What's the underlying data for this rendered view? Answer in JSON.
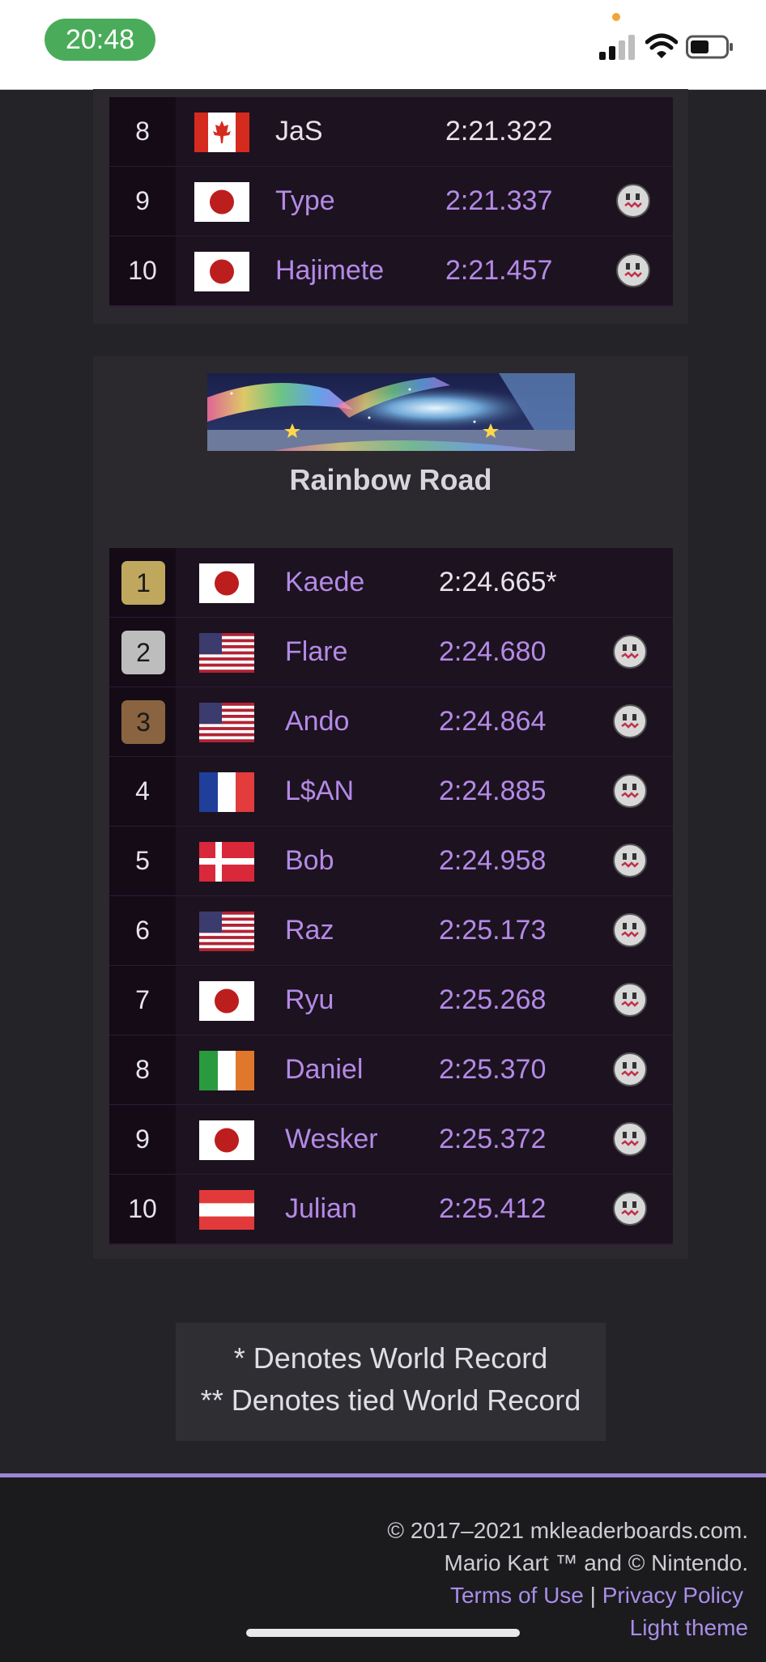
{
  "status": {
    "time": "20:48"
  },
  "top_table": {
    "rows": [
      {
        "rank": "8",
        "flag": "canada",
        "name": "JaS",
        "time": "2:21.322",
        "ghost": false
      },
      {
        "rank": "9",
        "flag": "japan",
        "name": "Type",
        "time": "2:21.337",
        "ghost": true
      },
      {
        "rank": "10",
        "flag": "japan",
        "name": "Hajimete",
        "time": "2:21.457",
        "ghost": true
      }
    ]
  },
  "rainbow": {
    "title": "Rainbow Road",
    "rows": [
      {
        "rank": "1",
        "medal": "gold",
        "flag": "japan",
        "name": "Kaede",
        "time": "2:24.665*",
        "ghost": false
      },
      {
        "rank": "2",
        "medal": "silver",
        "flag": "usa",
        "name": "Flare",
        "time": "2:24.680",
        "ghost": true
      },
      {
        "rank": "3",
        "medal": "bronze",
        "flag": "usa",
        "name": "Ando",
        "time": "2:24.864",
        "ghost": true
      },
      {
        "rank": "4",
        "flag": "france",
        "name": "L$AN",
        "time": "2:24.885",
        "ghost": true
      },
      {
        "rank": "5",
        "flag": "denmark",
        "name": "Bob",
        "time": "2:24.958",
        "ghost": true
      },
      {
        "rank": "6",
        "flag": "usa",
        "name": "Raz",
        "time": "2:25.173",
        "ghost": true
      },
      {
        "rank": "7",
        "flag": "japan",
        "name": "Ryu",
        "time": "2:25.268",
        "ghost": true
      },
      {
        "rank": "8",
        "flag": "ireland",
        "name": "Daniel",
        "time": "2:25.370",
        "ghost": true
      },
      {
        "rank": "9",
        "flag": "japan",
        "name": "Wesker",
        "time": "2:25.372",
        "ghost": true
      },
      {
        "rank": "10",
        "flag": "austria",
        "name": "Julian",
        "time": "2:25.412",
        "ghost": true
      }
    ]
  },
  "legend": {
    "line1": "* Denotes World Record",
    "line2": "** Denotes tied World Record"
  },
  "footer": {
    "copyright": "© 2017–2021 mkleaderboards.com.",
    "trademark": "Mario Kart ™ and © Nintendo.",
    "terms": "Terms of Use",
    "separator": "|",
    "privacy": "Privacy Policy",
    "theme": "Light theme"
  },
  "colors": {
    "accent": "#b48ae6",
    "gold": "#bfa85e",
    "silver": "#bdbdbd",
    "bronze": "#8a6440"
  },
  "icons": {
    "ghost": "boo-ghost-icon"
  }
}
